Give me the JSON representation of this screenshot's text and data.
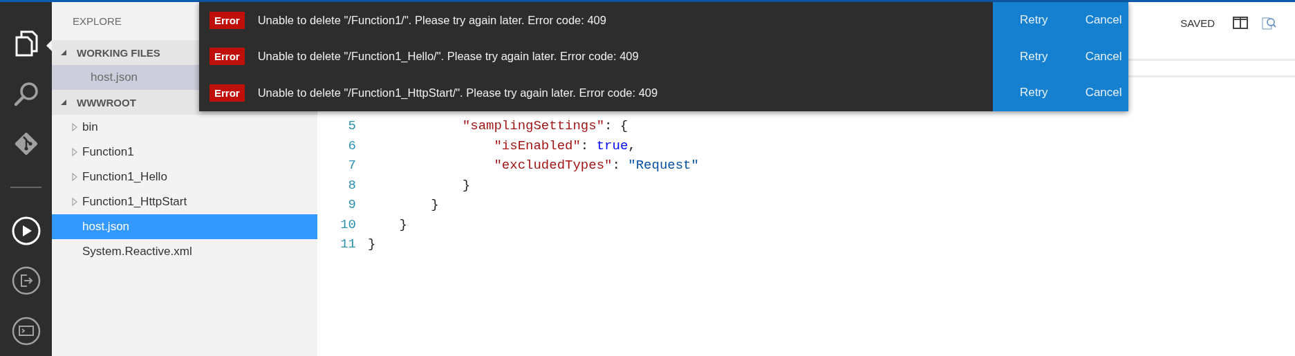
{
  "activity_bar": {
    "items": [
      {
        "kind": "files",
        "selected": true
      },
      {
        "kind": "search",
        "selected": false
      },
      {
        "kind": "git",
        "selected": false
      },
      {
        "kind": "run",
        "selected": false
      },
      {
        "kind": "output",
        "selected": false
      },
      {
        "kind": "console",
        "selected": false
      }
    ]
  },
  "sidebar": {
    "title": "EXPLORE",
    "sections": [
      {
        "title": "WORKING FILES",
        "expanded": true,
        "items": [
          {
            "label": "host.json",
            "kind": "file",
            "selected": true
          }
        ]
      },
      {
        "title": "WWWROOT",
        "expanded": true,
        "items": [
          {
            "label": "bin",
            "kind": "folder",
            "selected": false
          },
          {
            "label": "Function1",
            "kind": "folder",
            "selected": false
          },
          {
            "label": "Function1_Hello",
            "kind": "folder",
            "selected": false
          },
          {
            "label": "Function1_HttpStart",
            "kind": "folder",
            "selected": false
          },
          {
            "label": "host.json",
            "kind": "file",
            "selected": true
          },
          {
            "label": "System.Reactive.xml",
            "kind": "file",
            "selected": false
          }
        ]
      }
    ]
  },
  "editor": {
    "status": "SAVED",
    "lines": [
      {
        "number": "5",
        "tokens": [
          {
            "kind": "key",
            "text": "            \"samplingSettings\""
          },
          {
            "kind": "punct",
            "text": ": {"
          }
        ]
      },
      {
        "number": "6",
        "tokens": [
          {
            "kind": "key",
            "text": "                \"isEnabled\""
          },
          {
            "kind": "punct",
            "text": ": "
          },
          {
            "kind": "bool",
            "text": "true"
          },
          {
            "kind": "punct",
            "text": ","
          }
        ]
      },
      {
        "number": "7",
        "tokens": [
          {
            "kind": "key",
            "text": "                \"excludedTypes\""
          },
          {
            "kind": "punct",
            "text": ": "
          },
          {
            "kind": "string",
            "text": "\"Request\""
          }
        ]
      },
      {
        "number": "8",
        "tokens": [
          {
            "kind": "punct",
            "text": "            }"
          }
        ]
      },
      {
        "number": "9",
        "tokens": [
          {
            "kind": "punct",
            "text": "        }"
          }
        ]
      },
      {
        "number": "10",
        "tokens": [
          {
            "kind": "punct",
            "text": "    }"
          }
        ]
      },
      {
        "number": "11",
        "tokens": [
          {
            "kind": "punct",
            "text": "}"
          }
        ]
      }
    ]
  },
  "notifications": [
    {
      "badge": "Error",
      "message": "Unable to delete \"/Function1/\". Please try again later. Error code: 409",
      "actions": [
        "Retry",
        "Cancel"
      ]
    },
    {
      "badge": "Error",
      "message": "Unable to delete \"/Function1_Hello/\". Please try again later. Error code: 409",
      "actions": [
        "Retry",
        "Cancel"
      ]
    },
    {
      "badge": "Error",
      "message": "Unable to delete \"/Function1_HttpStart/\". Please try again later. Error code: 409",
      "actions": [
        "Retry",
        "Cancel"
      ]
    }
  ]
}
